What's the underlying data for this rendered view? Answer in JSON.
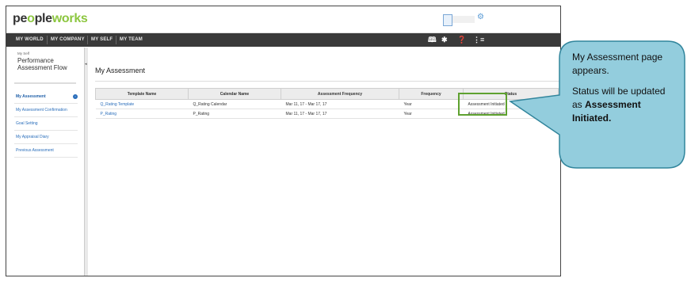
{
  "app": {
    "logo_part1": "pe",
    "logo_o": "o",
    "logo_part2": "ple",
    "logo_part3": "works"
  },
  "nav": {
    "items": [
      "MY WORLD",
      "MY COMPANY",
      "MY SELF",
      "MY TEAM"
    ],
    "icons": {
      "book": "book-icon",
      "asterisk": "asterisk-icon",
      "help": "help-icon",
      "menu": "menu-icon"
    }
  },
  "sidebar": {
    "crumb": "My Self",
    "title": "Performance Assessment Flow",
    "links": [
      "My Assessment",
      "My Assessment Confirmation",
      "Goal Setting",
      "My Appraisal Diary",
      "Previous Assessment"
    ],
    "active_index": 0
  },
  "main": {
    "heading": "My Assessment",
    "columns": [
      "Template Name",
      "Calendar Name",
      "Assessment Frequency",
      "Frequency",
      "Status"
    ],
    "rows": [
      [
        "Q_Rating Template",
        "Q_Rating Calendar",
        "Mar 11, 17 - Mar 17, 17",
        "Year",
        "Assessment Initiated"
      ],
      [
        "P_Rating",
        "P_Rating",
        "Mar 11, 17 - Mar 17, 17",
        "Year",
        "Assessment Initiated"
      ]
    ]
  },
  "callout": {
    "line1": "My Assessment page appears.",
    "line2_prefix": "Status will be updated as ",
    "line2_bold": "Assessment Initiated."
  },
  "colors": {
    "accent_green": "#8cc63f",
    "highlight_border": "#5ea12f",
    "callout_fill": "#93cddd",
    "callout_border": "#31859c",
    "link": "#2a6ebb"
  }
}
